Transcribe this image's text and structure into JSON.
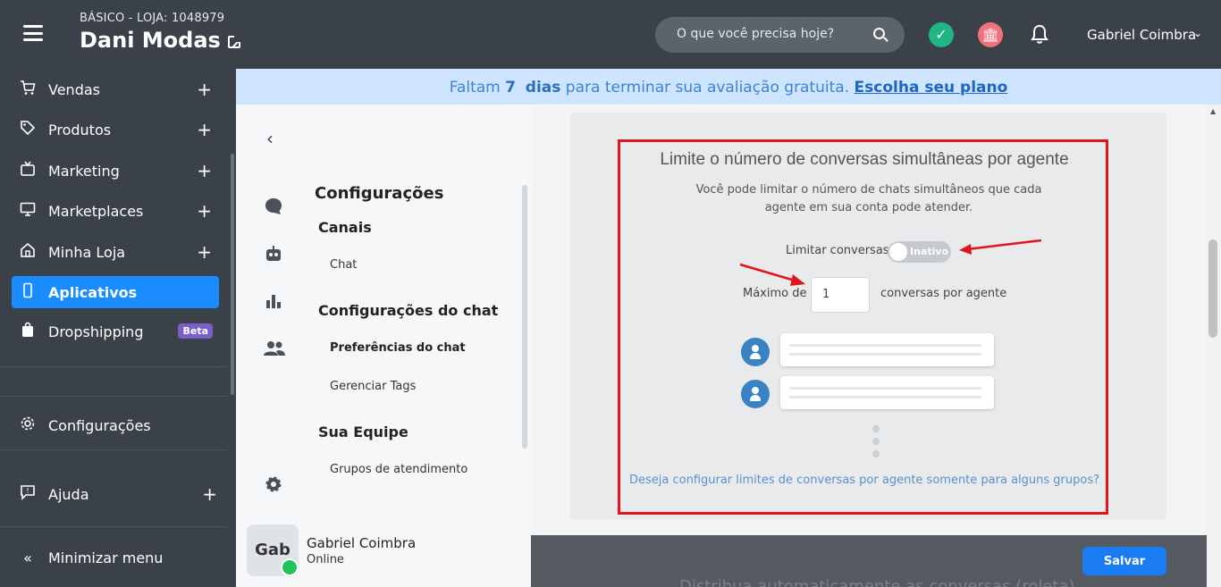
{
  "header": {
    "store_plan": "BÁSICO - LOJA: 1048979",
    "store_name": "Dani Modas",
    "search_placeholder": "O que você precisa hoje?",
    "user_name": "Gabriel Coimbra"
  },
  "sidebar": {
    "items": [
      {
        "label": "Vendas",
        "icon": "cart-icon"
      },
      {
        "label": "Produtos",
        "icon": "tag-icon"
      },
      {
        "label": "Marketing",
        "icon": "tv-icon"
      },
      {
        "label": "Marketplaces",
        "icon": "monitor-icon"
      },
      {
        "label": "Minha Loja",
        "icon": "home-icon"
      },
      {
        "label": "Aplicativos",
        "icon": "phone-icon"
      },
      {
        "label": "Dropshipping",
        "icon": "bag-icon",
        "badge": "Beta"
      }
    ],
    "settings": "Configurações",
    "help": "Ajuda",
    "minimize": "Minimizar menu"
  },
  "trial": {
    "prefix": "Faltam",
    "days": "7",
    "days_label": "dias",
    "middle": "para terminar sua avaliação gratuita.",
    "link": "Escolha seu plano"
  },
  "settings_panel": {
    "title": "Configurações",
    "section_channels": "Canais",
    "link_chat": "Chat",
    "section_chat_config": "Configurações do chat",
    "link_preferences": "Preferências do chat",
    "link_tags": "Gerenciar Tags",
    "section_team": "Sua Equipe",
    "link_groups": "Grupos de atendimento",
    "agent_initials": "Gab",
    "agent_name": "Gabriel Coimbra",
    "agent_status": "Online"
  },
  "main": {
    "title": "Limite o número de conversas simultâneas por agente",
    "description": "Você pode limitar o número de chats simultâneos que cada agente em sua conta pode atender.",
    "limit_label": "Limitar conversas",
    "toggle_text": "Inativo",
    "max_label": "Máximo de",
    "max_value": "1",
    "conv_label": "conversas por agente",
    "group_link": "Deseja configurar limites de conversas por agente somente para alguns grupos?",
    "footer_text": "Distribua automaticamente as conversas (roleta)",
    "save_label": "Salvar"
  },
  "colors": {
    "topbar": "#3a4149",
    "accent": "#1a8cff",
    "highlight": "#e0141e",
    "online": "#21c35a"
  }
}
